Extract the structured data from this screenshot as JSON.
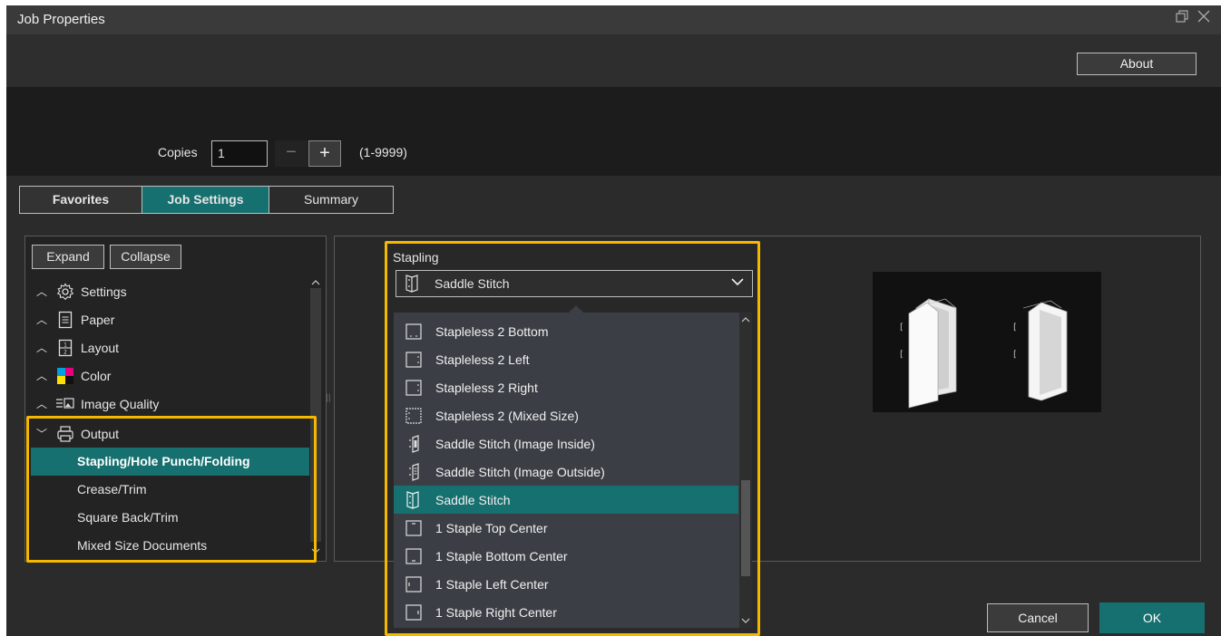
{
  "window": {
    "title": "Job Properties",
    "restore_icon": "restore-icon",
    "close_icon": "close-icon"
  },
  "header": {
    "about_label": "About"
  },
  "copies": {
    "label": "Copies",
    "value": "1",
    "minus": "−",
    "plus": "+",
    "range": "(1-9999)"
  },
  "tabs": [
    {
      "label": "Favorites"
    },
    {
      "label": "Job Settings",
      "active": true
    },
    {
      "label": "Summary"
    }
  ],
  "tree": {
    "expand_label": "Expand",
    "collapse_label": "Collapse",
    "items": [
      {
        "label": "Settings",
        "icon": "gear-icon",
        "expanded": false
      },
      {
        "label": "Paper",
        "icon": "paper-icon",
        "expanded": false
      },
      {
        "label": "Layout",
        "icon": "layout-icon",
        "expanded": false
      },
      {
        "label": "Color",
        "icon": "color-icon",
        "expanded": false
      },
      {
        "label": "Image Quality",
        "icon": "image-quality-icon",
        "expanded": false
      },
      {
        "label": "Output",
        "icon": "printer-icon",
        "expanded": true
      }
    ],
    "output_children": [
      {
        "label": "Stapling/Hole Punch/Folding",
        "selected": true
      },
      {
        "label": "Crease/Trim"
      },
      {
        "label": "Square Back/Trim"
      },
      {
        "label": "Mixed Size Documents"
      }
    ]
  },
  "stapling": {
    "label": "Stapling",
    "selected": "Saddle Stitch",
    "options": [
      {
        "label": "Stapleless 2 Bottom",
        "icon": "stapleless-bottom-icon"
      },
      {
        "label": "Stapleless 2 Left",
        "icon": "stapleless-left-icon"
      },
      {
        "label": "Stapleless 2 Right",
        "icon": "stapleless-right-icon"
      },
      {
        "label": "Stapleless 2 (Mixed Size)",
        "icon": "stapleless-mixed-icon"
      },
      {
        "label": "Saddle Stitch (Image Inside)",
        "icon": "saddle-inside-icon"
      },
      {
        "label": "Saddle Stitch (Image Outside)",
        "icon": "saddle-outside-icon"
      },
      {
        "label": "Saddle Stitch",
        "icon": "saddle-stitch-icon",
        "selected": true
      },
      {
        "label": "1 Staple Top Center",
        "icon": "staple-top-icon"
      },
      {
        "label": "1 Staple Bottom Center",
        "icon": "staple-bottom-icon"
      },
      {
        "label": "1 Staple Left Center",
        "icon": "staple-left-icon"
      },
      {
        "label": "1 Staple Right Center",
        "icon": "staple-right-icon"
      }
    ]
  },
  "footer": {
    "cancel_label": "Cancel",
    "ok_label": "OK"
  },
  "colors": {
    "accent": "#16706f",
    "highlight": "#f5b800",
    "background": "#2b2b2b"
  }
}
